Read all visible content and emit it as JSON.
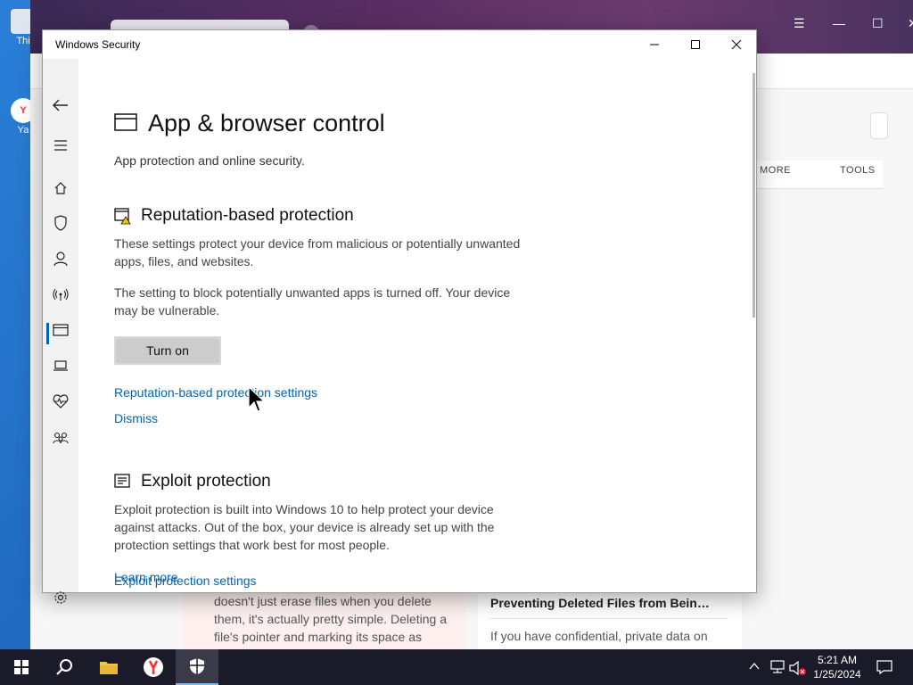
{
  "desktop": {
    "icons": [
      {
        "label": "Thi"
      },
      {
        "label": "Ya"
      }
    ]
  },
  "background_browser": {
    "nav": {
      "more": "MORE",
      "tools": "TOOLS"
    },
    "card_left_lines": [
      "doesn't just erase files when you delete",
      "them, it's actually pretty simple. Deleting a",
      "file's pointer and marking its space as"
    ],
    "card_right": {
      "heading": "Preventing Deleted Files from Bein…",
      "text": "If you have confidential, private data on"
    }
  },
  "window": {
    "title": "Windows Security",
    "controls": {
      "minimize_icon": "minimize-icon",
      "maximize_icon": "maximize-icon",
      "close_icon": "close-icon"
    }
  },
  "sidebar": {
    "items": [
      {
        "name": "back",
        "icon": "back-arrow-icon"
      },
      {
        "name": "menu",
        "icon": "hamburger-icon"
      },
      {
        "name": "home",
        "icon": "home-icon"
      },
      {
        "name": "virus-protection",
        "icon": "shield-icon"
      },
      {
        "name": "account-protection",
        "icon": "person-icon"
      },
      {
        "name": "firewall",
        "icon": "antenna-icon"
      },
      {
        "name": "app-browser-control",
        "icon": "browser-window-icon",
        "active": true
      },
      {
        "name": "device-security",
        "icon": "laptop-icon"
      },
      {
        "name": "device-performance",
        "icon": "heart-pulse-icon"
      },
      {
        "name": "family-options",
        "icon": "family-icon"
      },
      {
        "name": "settings",
        "icon": "gear-icon"
      }
    ]
  },
  "page": {
    "title": "App & browser control",
    "subtitle": "App protection and online security.",
    "reputation": {
      "heading": "Reputation-based protection",
      "desc_line1": "These settings protect your device from malicious or potentially unwanted",
      "desc_line2": "apps, files, and websites.",
      "warning_line1": "The setting to block potentially unwanted apps is turned off. Your device",
      "warning_line2": "may be vulnerable.",
      "button": "Turn on",
      "settings_link": "Reputation-based protection settings",
      "dismiss_link": "Dismiss"
    },
    "exploit": {
      "heading": "Exploit protection",
      "desc_line1": "Exploit protection is built into Windows 10 to help protect your device",
      "desc_line2": "against attacks.  Out of the box, your device is already set up with the",
      "desc_line3": "protection settings that work best for most people.",
      "settings_link": "Exploit protection settings",
      "learn_more": "Learn more"
    }
  },
  "taskbar": {
    "time": "5:21 AM",
    "date": "1/25/2024"
  },
  "colors": {
    "accent": "#0063b1",
    "link": "#0066b4",
    "taskbar": "#1a1a28",
    "warning": "#f5c400"
  }
}
